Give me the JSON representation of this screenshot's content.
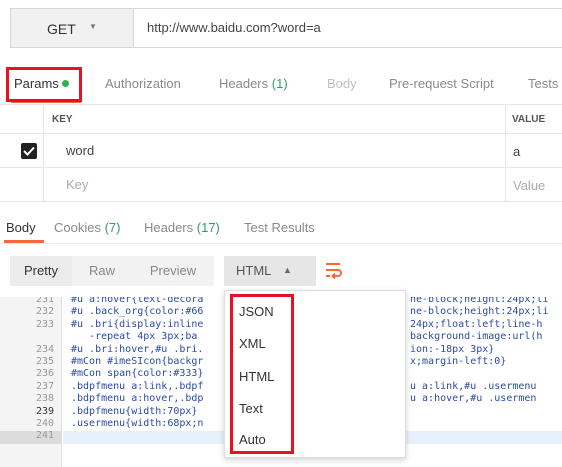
{
  "request": {
    "method": "GET",
    "url": "http://www.baidu.com?word=a"
  },
  "request_tabs": [
    {
      "label": "Params",
      "active": true,
      "dot": true
    },
    {
      "label": "Authorization"
    },
    {
      "label": "Headers",
      "count": "(1)"
    },
    {
      "label": "Body",
      "disabled": true
    },
    {
      "label": "Pre-request Script"
    },
    {
      "label": "Tests"
    }
  ],
  "params": {
    "headers": {
      "key": "KEY",
      "value": "VALUE"
    },
    "rows": [
      {
        "checked": true,
        "key": "word",
        "value": "a"
      }
    ],
    "placeholder": {
      "key": "Key",
      "value": "Value"
    }
  },
  "response_tabs": [
    {
      "label": "Body",
      "active": true
    },
    {
      "label": "Cookies",
      "count": "(7)"
    },
    {
      "label": "Headers",
      "count": "(17)"
    },
    {
      "label": "Test Results"
    }
  ],
  "format_toolbar": {
    "pretty": "Pretty",
    "raw": "Raw",
    "preview": "Preview",
    "selected_format": "HTML",
    "caret": "▲"
  },
  "format_options": [
    "JSON",
    "XML",
    "HTML",
    "Text",
    "Auto"
  ],
  "editor": {
    "highlighted_line": "239",
    "lines": [
      {
        "no": "231",
        "code": "#u a:hover{text-decora",
        "right": "ne-block;height:24px;li"
      },
      {
        "no": "232",
        "code": "#u .back_org{color:#66",
        "right": "ne-block;height:24px;li"
      },
      {
        "no": "233",
        "code": "#u .bri{display:inline",
        "right": "24px;float:left;line-h"
      },
      {
        "no": "",
        "code": "   -repeat 4px 3px;ba",
        "right": "background-image:url(h"
      },
      {
        "no": "234",
        "code": "#u .bri:hover,#u .bri.",
        "right": "ion:-18px 3px}"
      },
      {
        "no": "235",
        "code": "#mCon #imeSIcon{backgr",
        "right": "x;margin-left:0}"
      },
      {
        "no": "236",
        "code": "#mCon span{color:#333}",
        "right": ""
      },
      {
        "no": "237",
        "code": ".bdpfmenu a:link,.bdpf",
        "right": "u a:link,#u .usermenu"
      },
      {
        "no": "238",
        "code": ".bdpfmenu a:hover,.bdp",
        "right": "u a:hover,#u .usermen"
      },
      {
        "no": "239",
        "code": ".bdpfmenu{width:70px}",
        "right": ""
      },
      {
        "no": "240",
        "code": ".usermenu{width:68px;n",
        "right": ""
      },
      {
        "no": "241",
        "code": "",
        "right": ""
      }
    ]
  },
  "colors": {
    "accent": "#f26b3a",
    "count_green": "#2e9e63",
    "status_dot": "#2eb34a",
    "annotation_red": "#e81123"
  }
}
